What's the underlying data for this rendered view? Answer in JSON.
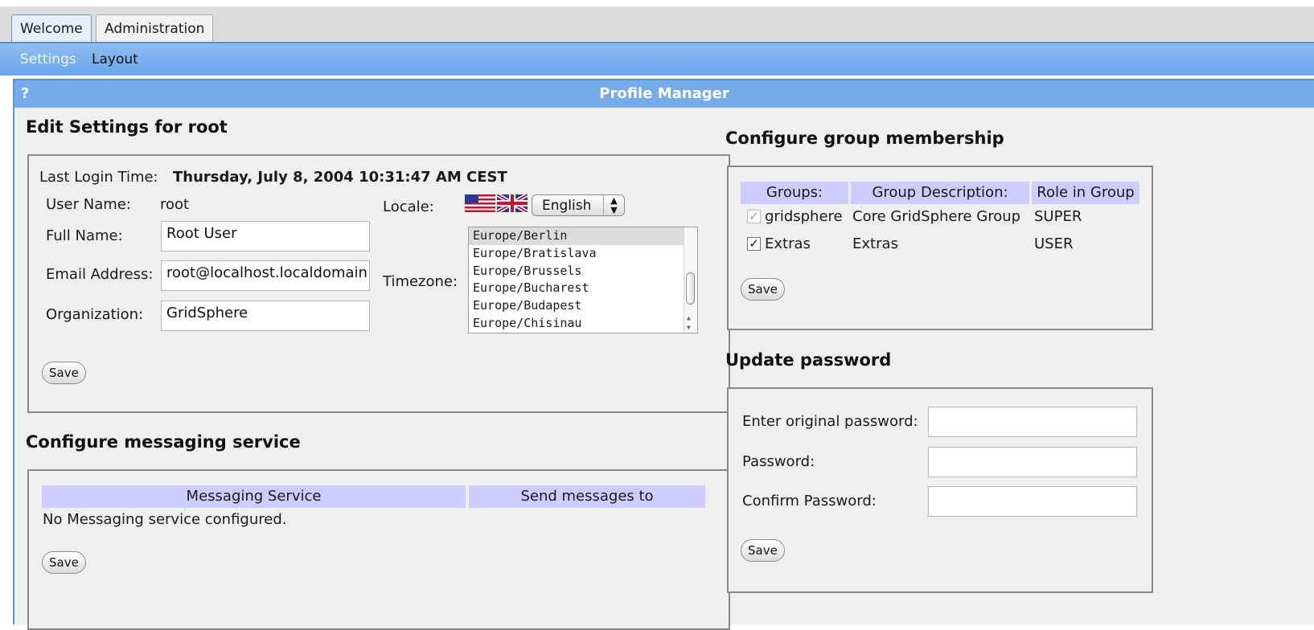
{
  "tabs": [
    {
      "label": "Welcome",
      "active": true
    },
    {
      "label": "Administration",
      "active": false
    }
  ],
  "subnav": [
    {
      "label": "Settings",
      "active": true
    },
    {
      "label": "Layout",
      "active": false
    }
  ],
  "portlet": {
    "help": "?",
    "title": "Profile Manager"
  },
  "edit_settings": {
    "heading": "Edit Settings for  root",
    "last_login_label": "Last Login Time:",
    "last_login_value": "Thursday, July 8, 2004 10:31:47 AM CEST",
    "user_name_label": "User Name:",
    "user_name_value": "root",
    "full_name_label": "Full Name:",
    "full_name_value": "Root User",
    "email_label": "Email Address:",
    "email_value": "root@localhost.localdomain",
    "org_label": "Organization:",
    "org_value": "GridSphere",
    "locale_label": "Locale:",
    "locale_value": "English",
    "timezone_label": "Timezone:",
    "timezones": [
      "Europe/Berlin",
      "Europe/Bratislava",
      "Europe/Brussels",
      "Europe/Bucharest",
      "Europe/Budapest",
      "Europe/Chisinau"
    ],
    "timezone_selected": "Europe/Berlin",
    "save_label": "Save"
  },
  "messaging": {
    "heading": "Configure messaging service",
    "col_service": "Messaging Service",
    "col_send": "Send messages to",
    "empty_text": "No Messaging service configured.",
    "save_label": "Save"
  },
  "groups": {
    "heading": "Configure group membership",
    "col_groups": "Groups:",
    "col_desc": "Group Description:",
    "col_role": "Role in Group",
    "rows": [
      {
        "name": "gridsphere",
        "description": "Core GridSphere Group",
        "role": "SUPER",
        "checked": true,
        "disabled": true
      },
      {
        "name": "Extras",
        "description": "Extras",
        "role": "USER",
        "checked": true,
        "disabled": false
      }
    ],
    "save_label": "Save"
  },
  "password": {
    "heading": "Update password",
    "original_label": "Enter original password:",
    "password_label": "Password:",
    "confirm_label": "Confirm Password:",
    "save_label": "Save"
  },
  "colors": {
    "tab_border": "#5b8fd6",
    "subnav": "#7ab0ee",
    "portlet_title": "#74abe8",
    "table_header": "#ccccff"
  }
}
